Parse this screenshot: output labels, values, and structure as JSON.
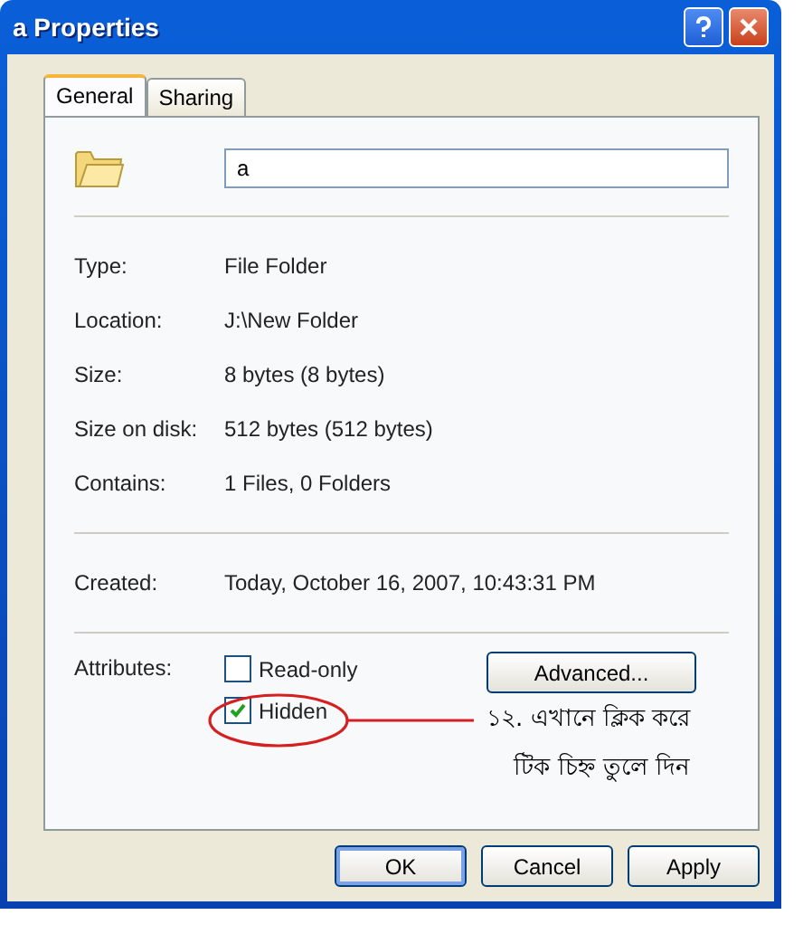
{
  "window": {
    "title": "a Properties"
  },
  "tabs": [
    {
      "label": "General",
      "selected": true
    },
    {
      "label": "Sharing",
      "selected": false
    }
  ],
  "name_field": {
    "value": "a"
  },
  "groups": [
    [
      {
        "label": "Type:",
        "value": "File Folder"
      },
      {
        "label": "Location:",
        "value": "J:\\New Folder"
      },
      {
        "label": "Size:",
        "value": "8 bytes (8 bytes)"
      },
      {
        "label": "Size on disk:",
        "value": "512 bytes (512 bytes)"
      },
      {
        "label": "Contains:",
        "value": "1 Files, 0 Folders"
      }
    ],
    [
      {
        "label": "Created:",
        "value": "Today, October 16, 2007, 10:43:31 PM"
      }
    ]
  ],
  "attributes": {
    "label": "Attributes:",
    "items": [
      {
        "label": "Read-only",
        "checked": false
      },
      {
        "label": "Hidden",
        "checked": true
      }
    ],
    "advanced_button": "Advanced..."
  },
  "annotation": {
    "lines": [
      "১২. এখানে ক্লিক করে",
      "টিক চিহ্ন তুলে দিন"
    ]
  },
  "buttons": [
    "OK",
    "Cancel",
    "Apply"
  ]
}
